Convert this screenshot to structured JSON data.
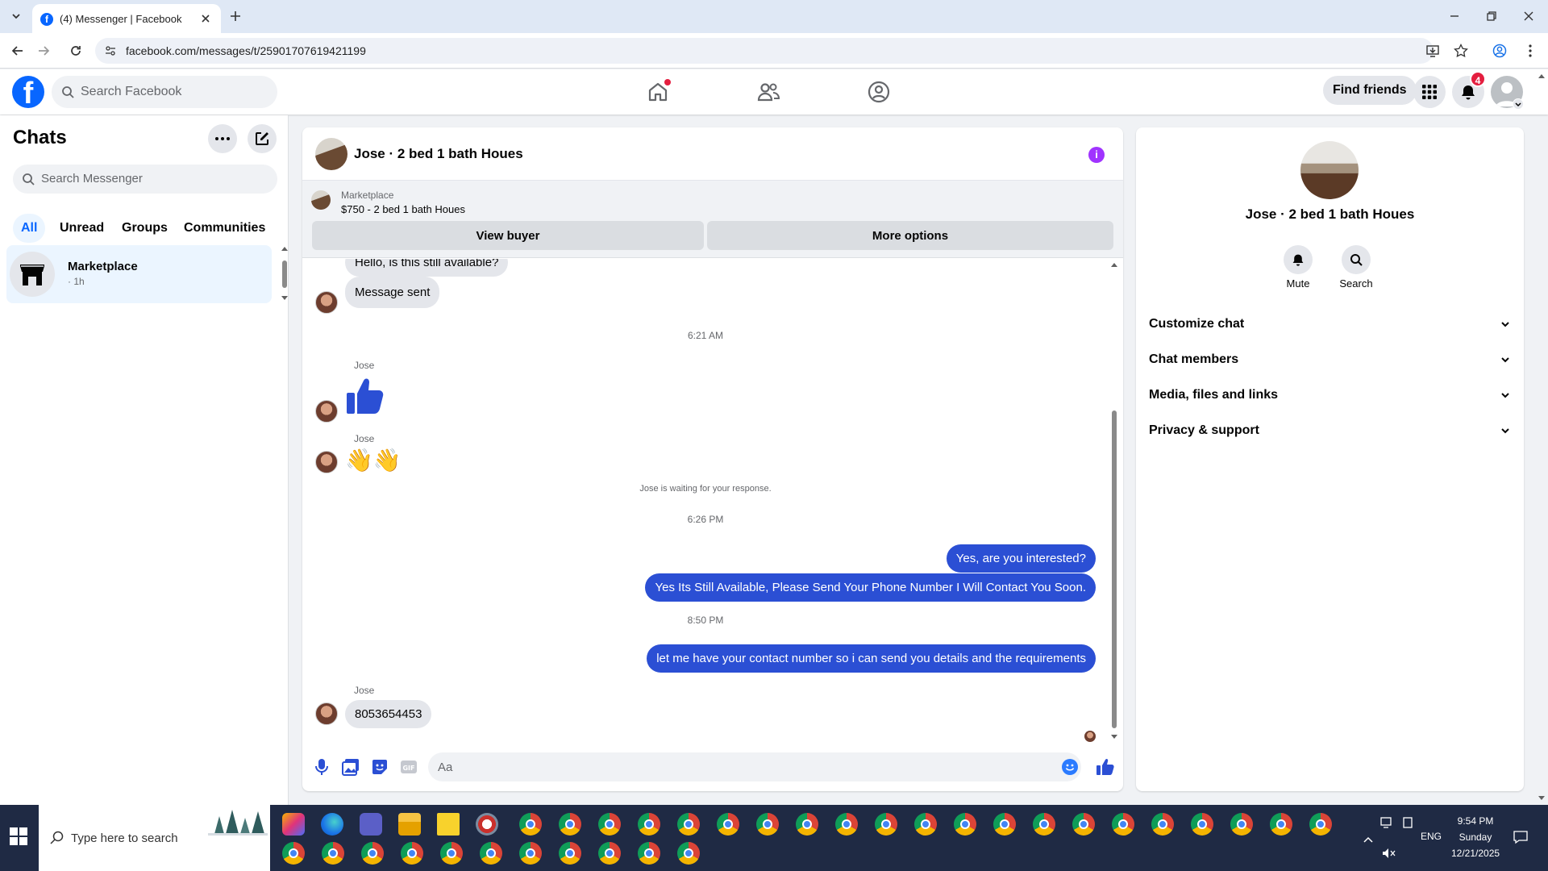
{
  "browser": {
    "tab_title": "(4) Messenger | Facebook",
    "url": "facebook.com/messages/t/25901707619421199"
  },
  "fbnav": {
    "search_placeholder": "Search Facebook",
    "find_friends": "Find friends",
    "notif_count": "4"
  },
  "chats": {
    "title": "Chats",
    "search_placeholder": "Search Messenger",
    "filters": [
      "All",
      "Unread",
      "Groups",
      "Communities"
    ],
    "items": [
      {
        "name": "Marketplace",
        "time": "· 1h"
      }
    ]
  },
  "conversation": {
    "title": "Jose · 2 bed 1 bath Houes",
    "marketplace": {
      "label": "Marketplace",
      "listing": "$750 - 2 bed 1 bath Houes",
      "view_buyer": "View buyer",
      "more_options": "More options"
    },
    "messages": {
      "m1": "Hello, is this still available?",
      "m2": "Message sent",
      "t1": "6:21 AM",
      "sender": "Jose",
      "m4": "👋👋",
      "waiting": "Jose is waiting for your response.",
      "t2": "6:26 PM",
      "o1": "Yes, are you interested?",
      "o2": "Yes Its Still Available, Please Send Your Phone Number I Will Contact You Soon.",
      "t3": "8:50 PM",
      "o3": "let me have your contact number so i can send you details and the requirements",
      "m5": "8053654453"
    },
    "composer_placeholder": "Aa"
  },
  "info": {
    "name": "Jose · 2 bed 1 bath Houes",
    "mute": "Mute",
    "search": "Search",
    "sections": [
      "Customize chat",
      "Chat members",
      "Media, files and links",
      "Privacy & support"
    ]
  },
  "taskbar": {
    "search_placeholder": "Type here to search",
    "lang": "ENG",
    "time": "9:54 PM",
    "day": "Sunday",
    "date": "12/21/2025"
  },
  "colors": {
    "fb_blue": "#0866ff",
    "outgoing_bubble": "#2b4fd4",
    "info_icon": "#a033ff",
    "notif_red": "#e41e3f"
  }
}
